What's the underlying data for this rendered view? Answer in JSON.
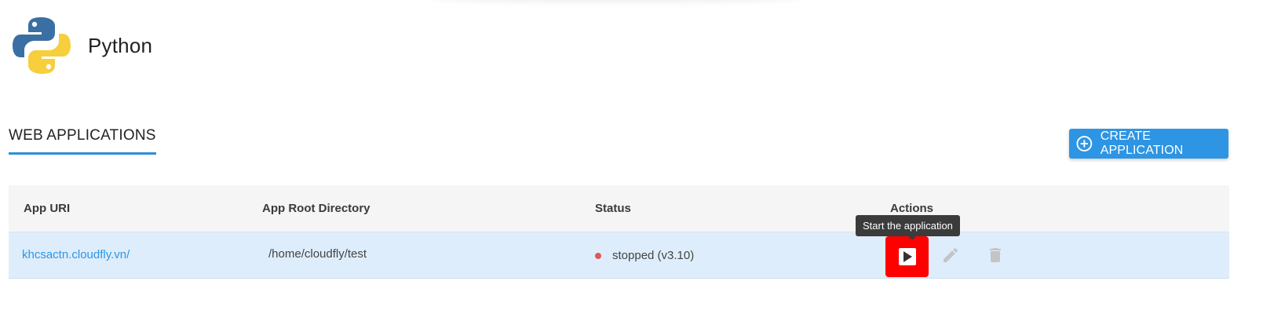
{
  "app": {
    "title": "Python",
    "logo_icon": "python-logo-icon"
  },
  "section": {
    "title": "WEB APPLICATIONS"
  },
  "create_button": {
    "label": "CREATE APPLICATION",
    "icon": "plus-circle-icon",
    "color": "#2d95e3"
  },
  "table": {
    "headers": [
      "App URI",
      "App Root Directory",
      "Status",
      "Actions"
    ],
    "rows": [
      {
        "app_uri": "khcsactn.cloudfly.vn/",
        "root_dir": "/home/cloudfly/test",
        "status": "stopped (v3.10)",
        "status_color": "#e05858",
        "actions": [
          "play-icon",
          "edit-icon",
          "delete-icon"
        ]
      }
    ]
  },
  "tooltip": {
    "text": "Start the application"
  },
  "colors": {
    "accent": "#2d95e3",
    "highlight": "#ff0000",
    "row_bg": "#deedfb"
  }
}
